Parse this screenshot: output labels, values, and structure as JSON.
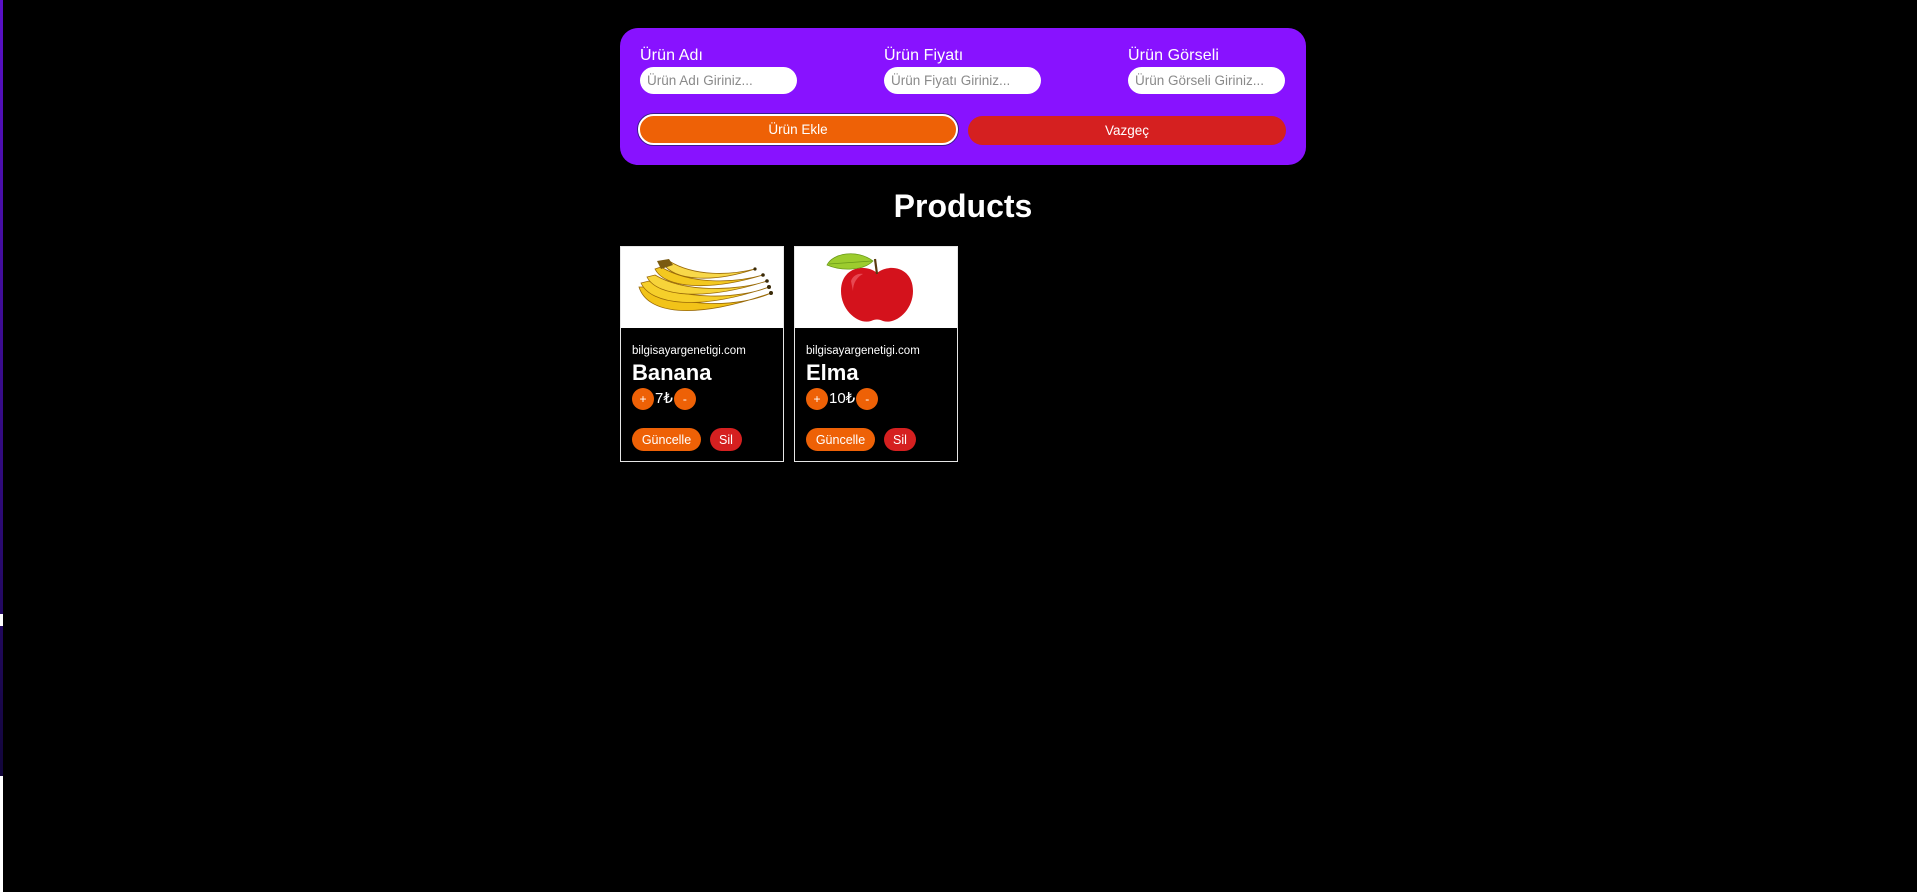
{
  "form": {
    "fields": [
      {
        "label": "Ürün Adı",
        "placeholder": "Ürün Adı Giriniz...",
        "value": ""
      },
      {
        "label": "Ürün Fiyatı",
        "placeholder": "Ürün Fiyatı Giriniz...",
        "value": ""
      },
      {
        "label": "Ürün Görseli",
        "placeholder": "Ürün Görseli Giriniz...",
        "value": ""
      }
    ],
    "add_label": "Ürün Ekle",
    "cancel_label": "Vazgeç"
  },
  "title": "Products",
  "products": [
    {
      "image_icon": "banana-image",
      "site": "bilgisayargenetigi.com",
      "name": "Banana",
      "price": "7₺",
      "plus_label": "+",
      "minus_label": "-",
      "update_label": "Güncelle",
      "delete_label": "Sil"
    },
    {
      "image_icon": "apple-image",
      "site": "bilgisayargenetigi.com",
      "name": "Elma",
      "price": "10₺",
      "plus_label": "+",
      "minus_label": "-",
      "update_label": "Güncelle",
      "delete_label": "Sil"
    }
  ],
  "colors": {
    "panel": "#8812ff",
    "accent": "#ee6106",
    "danger": "#d52020",
    "background": "#000000"
  }
}
